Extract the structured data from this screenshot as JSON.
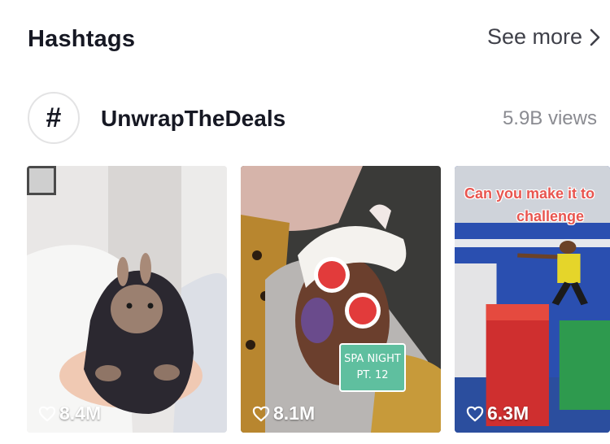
{
  "section": {
    "title": "Hashtags",
    "see_more_label": "See more"
  },
  "hashtag": {
    "symbol": "#",
    "name": "UnwrapTheDeals",
    "views": "5.9B views"
  },
  "videos": [
    {
      "likes": "8.4M",
      "subject": "bunny-in-hoodie"
    },
    {
      "likes": "8.1M",
      "subject": "spa-night-face-mask",
      "sticker_line1": "SPA NIGHT",
      "sticker_line2": "PT. 12"
    },
    {
      "likes": "6.3M",
      "subject": "gym-parkour-challenge",
      "caption_line1": "Can you make it to",
      "caption_line2": "challenge"
    }
  ],
  "colors": {
    "title_text": "#161823",
    "secondary_text": "#8a8b91",
    "sticker_green": "#5fbf9f",
    "caption_red": "#e8554f"
  }
}
